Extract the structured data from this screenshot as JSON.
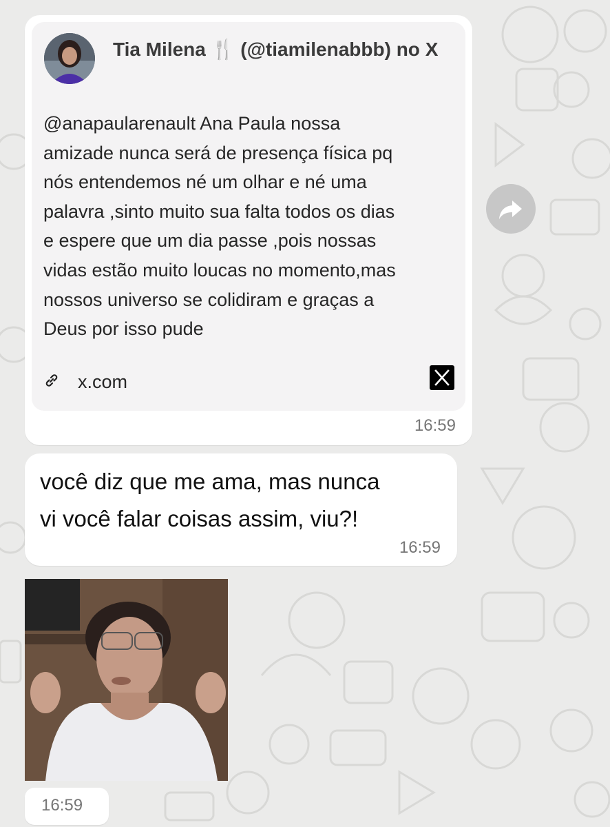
{
  "link_preview": {
    "title": "Tia Milena 🍴 (@tiamilenabbb) no X",
    "description": "@anapaularenault Ana Paula nossa\namizade nunca será de presença física pq\nnós entendemos né um olhar e né uma\npalavra ,sinto muito sua falta todos os dias\ne espere que um dia passe ,pois nossas\nvidas estão muito loucas no momento,mas\nnossos universo se colidiram e graças a\nDeus por isso pude",
    "domain": "x.com",
    "time": "16:59"
  },
  "message": {
    "text": "você diz que me ama, mas nunca\nvi você falar coisas assim, viu?!",
    "time": "16:59"
  },
  "gif_message": {
    "time": "16:59"
  },
  "icons": {
    "forward": "forward-arrow-icon",
    "link": "link-chain-icon",
    "x_logo": "x-logo-icon"
  },
  "colors": {
    "background": "#ebebea",
    "bubble": "#ffffff",
    "preview": "#f4f3f4",
    "forward_button": "#c7c7c7"
  }
}
